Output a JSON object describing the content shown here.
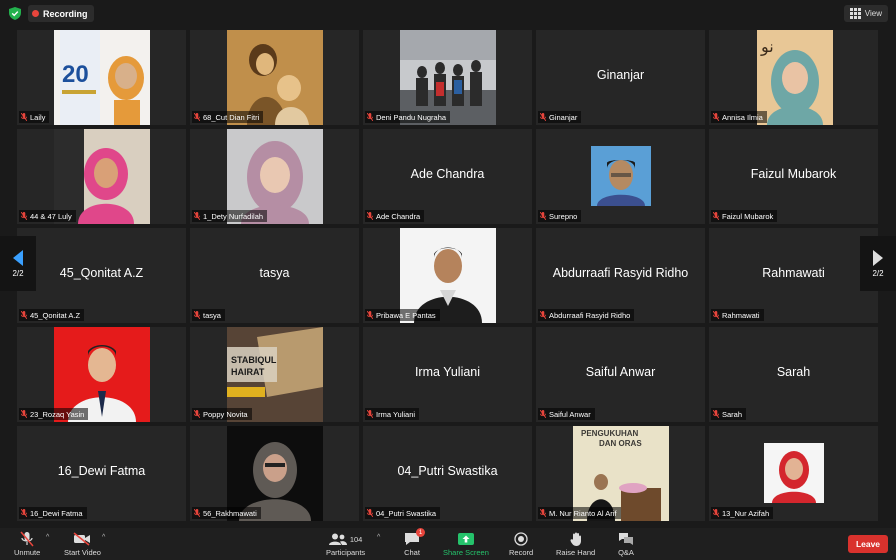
{
  "topbar": {
    "recording_label": "Recording",
    "view_label": "View"
  },
  "pager": {
    "left_label": "2/2",
    "right_label": "2/2"
  },
  "participants": [
    {
      "name": "Laily",
      "display": "",
      "photo": "laily"
    },
    {
      "name": "68_Cut Dian Fitri",
      "display": "",
      "photo": "sepia"
    },
    {
      "name": "Deni Pandu Nugraha",
      "display": "",
      "photo": "group"
    },
    {
      "name": "Ginanjar",
      "display": "Ginanjar",
      "photo": ""
    },
    {
      "name": "Annisa Ilmia",
      "display": "",
      "photo": "annisa"
    },
    {
      "name": "44 & 47 Luly",
      "display": "",
      "photo": "luly"
    },
    {
      "name": "1_Dety Nurfadilah",
      "display": "",
      "photo": "dety"
    },
    {
      "name": "Ade Chandra",
      "display": "Ade Chandra",
      "photo": ""
    },
    {
      "name": "Surepno",
      "display": "",
      "photo": "surepno"
    },
    {
      "name": "Faizul Mubarok",
      "display": "Faizul Mubarok",
      "photo": ""
    },
    {
      "name": "45_Qonitat A.Z",
      "display": "45_Qonitat A.Z",
      "photo": ""
    },
    {
      "name": "tasya",
      "display": "tasya",
      "photo": ""
    },
    {
      "name": "Pribawa E Pantas",
      "display": "",
      "photo": "pribawa"
    },
    {
      "name": "Abdurraafi Rasyid Ridho",
      "display": "Abdurraafi Rasyid Ridho",
      "photo": ""
    },
    {
      "name": "Rahmawati",
      "display": "Rahmawati",
      "photo": ""
    },
    {
      "name": "23_Rozaq Yasin",
      "display": "",
      "photo": "rozaq"
    },
    {
      "name": "Poppy Novita",
      "display": "",
      "photo": "poppy"
    },
    {
      "name": "Irma Yuliani",
      "display": "Irma Yuliani",
      "photo": ""
    },
    {
      "name": "Saiful Anwar",
      "display": "Saiful Anwar",
      "photo": ""
    },
    {
      "name": "Sarah",
      "display": "Sarah",
      "photo": ""
    },
    {
      "name": "16_Dewi Fatma",
      "display": "16_Dewi Fatma",
      "photo": ""
    },
    {
      "name": "56_Rakhmawati",
      "display": "",
      "photo": "rakhmawati"
    },
    {
      "name": "04_Putri Swastika",
      "display": "04_Putri Swastika",
      "photo": ""
    },
    {
      "name": "M. Nur Rianto Al Arif",
      "display": "",
      "photo": "rianto"
    },
    {
      "name": "13_Nur Azifah",
      "display": "",
      "photo": "azifah"
    }
  ],
  "toolbar": {
    "unmute_label": "Unmute",
    "start_video_label": "Start Video",
    "participants_label": "Participants",
    "participants_count": "104",
    "chat_label": "Chat",
    "chat_badge": "1",
    "share_label": "Share Screen",
    "record_label": "Record",
    "raise_hand_label": "Raise Hand",
    "qa_label": "Q&A",
    "leave_label": "Leave"
  },
  "colors": {
    "accent_green": "#25c26b",
    "leave_red": "#d9322d",
    "recording_red": "#e8453c",
    "tile_bg": "#262626"
  }
}
